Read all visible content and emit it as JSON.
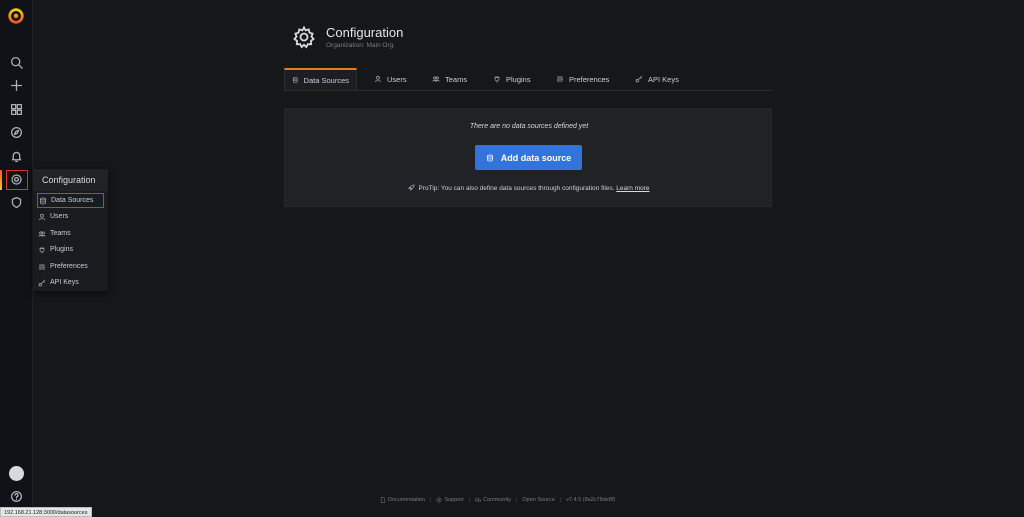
{
  "sidebar": {
    "items": [
      {
        "icon": "search-icon"
      },
      {
        "icon": "plus-icon"
      },
      {
        "icon": "dashboards-icon"
      },
      {
        "icon": "explore-icon"
      },
      {
        "icon": "alerting-bell-icon"
      },
      {
        "icon": "gear-icon"
      },
      {
        "icon": "shield-icon"
      }
    ],
    "help_icon": "help-icon"
  },
  "flyout": {
    "title": "Configuration",
    "items": [
      {
        "label": "Data Sources",
        "icon": "database-icon"
      },
      {
        "label": "Users",
        "icon": "user-icon"
      },
      {
        "label": "Teams",
        "icon": "users-icon"
      },
      {
        "label": "Plugins",
        "icon": "plug-icon"
      },
      {
        "label": "Preferences",
        "icon": "sliders-icon"
      },
      {
        "label": "API Keys",
        "icon": "key-icon"
      }
    ]
  },
  "header": {
    "title": "Configuration",
    "subtitle": "Organization: Main Org."
  },
  "tabs": [
    {
      "label": "Data Sources",
      "icon": "database-icon",
      "active": true
    },
    {
      "label": "Users",
      "icon": "user-icon"
    },
    {
      "label": "Teams",
      "icon": "users-icon"
    },
    {
      "label": "Plugins",
      "icon": "plug-icon"
    },
    {
      "label": "Preferences",
      "icon": "sliders-icon"
    },
    {
      "label": "API Keys",
      "icon": "key-icon"
    }
  ],
  "empty_state": {
    "message": "There are no data sources defined yet",
    "button_label": "Add data source",
    "protip": "ProTip: You can also define data sources through configuration files.",
    "learn_more": "Learn more"
  },
  "footer": {
    "documentation": "Documentation",
    "support": "Support",
    "community": "Community",
    "open_source": "Open Source",
    "version": "v7.4.5 (8a2c78de8f)"
  },
  "status_url": "192.168.21.128:3000/datasources",
  "colors": {
    "accent_blue": "#3274d9",
    "highlight_red": "#e02f2f",
    "tab_active_orange": "#eb7b18",
    "background": "#161719"
  }
}
